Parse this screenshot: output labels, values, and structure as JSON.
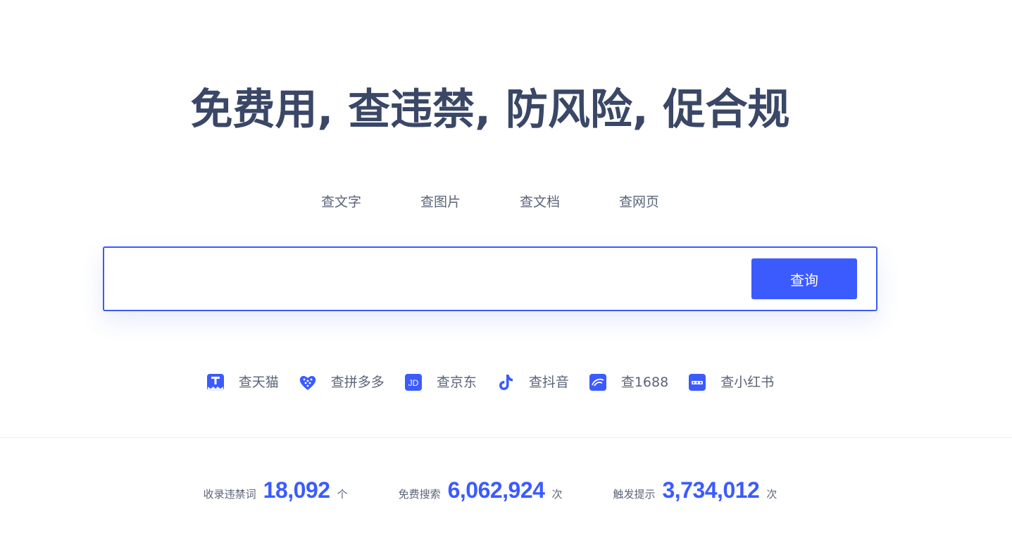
{
  "hero": {
    "title": "免费用, 查违禁, 防风险, 促合规"
  },
  "mode_tabs": [
    {
      "label": "查文字"
    },
    {
      "label": "查图片"
    },
    {
      "label": "查文档"
    },
    {
      "label": "查网页"
    }
  ],
  "search": {
    "value": "",
    "placeholder": "",
    "button_label": "查询"
  },
  "platforms": [
    {
      "label": "查天猫",
      "icon": "tmall-icon"
    },
    {
      "label": "查拼多多",
      "icon": "pinduoduo-icon"
    },
    {
      "label": "查京东",
      "icon": "jd-icon"
    },
    {
      "label": "查抖音",
      "icon": "douyin-icon"
    },
    {
      "label": "查1688",
      "icon": "alibaba-1688-icon"
    },
    {
      "label": "查小红书",
      "icon": "xiaohongshu-icon"
    }
  ],
  "stats": [
    {
      "label": "收录违禁词",
      "value": "18,092",
      "unit": "个"
    },
    {
      "label": "免费搜索",
      "value": "6,062,924",
      "unit": "次"
    },
    {
      "label": "触发提示",
      "value": "3,734,012",
      "unit": "次"
    }
  ],
  "colors": {
    "accent": "#3b5bff",
    "title": "#3a4766",
    "text": "#5a6478",
    "divider": "#eceef2"
  }
}
